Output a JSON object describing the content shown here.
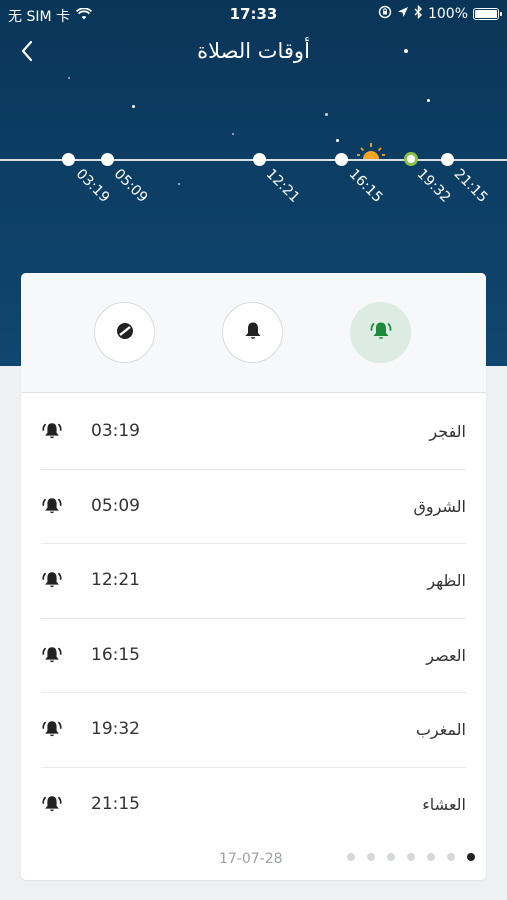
{
  "status_bar": {
    "carrier": "无 SIM 卡",
    "time": "17:33",
    "battery": "100%"
  },
  "header": {
    "title": "أوقات الصلاة",
    "back_icon": "chevron-left-icon"
  },
  "timeline": {
    "times": [
      "03:19",
      "05:09",
      "12:21",
      "16:15",
      "19:32",
      "21:15"
    ],
    "current_index": 4,
    "sun_icon": "sunset-icon"
  },
  "modes": [
    {
      "name": "silent",
      "icon": "no-sound-icon",
      "active": false
    },
    {
      "name": "notify",
      "icon": "bell-icon",
      "active": false
    },
    {
      "name": "adhan",
      "icon": "ringing-bell-icon",
      "active": true
    }
  ],
  "prayers": [
    {
      "name": "الفجر",
      "time": "03:19"
    },
    {
      "name": "الشروق",
      "time": "05:09"
    },
    {
      "name": "الظهر",
      "time": "12:21"
    },
    {
      "name": "العصر",
      "time": "16:15"
    },
    {
      "name": "المغرب",
      "time": "19:32"
    },
    {
      "name": "العشاء",
      "time": "21:15"
    }
  ],
  "footer": {
    "date": "17-07-28",
    "page_count": 7,
    "active_page": 7
  },
  "colors": {
    "sky_top": "#0a3558",
    "sky_bottom": "#104670",
    "accent_green": "#1e8a3c",
    "active_mode_bg": "#dcece2",
    "current_ring": "#8bc34a",
    "sun": "#f5a623"
  }
}
